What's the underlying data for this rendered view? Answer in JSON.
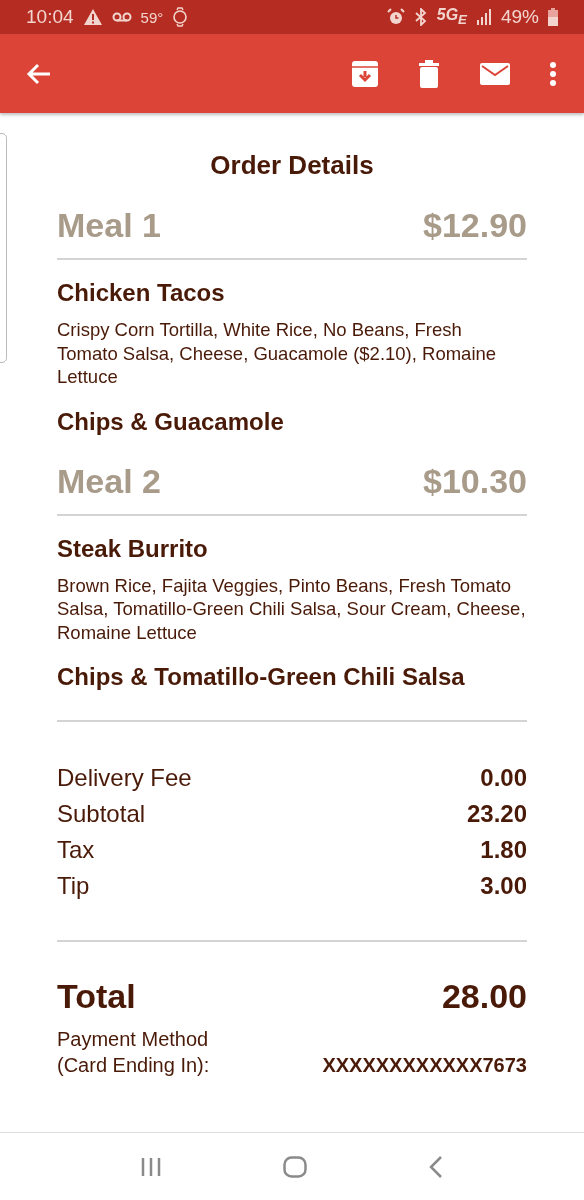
{
  "status_bar": {
    "time": "10:04",
    "temperature": "59°",
    "network": "5G$_{E}$",
    "battery": "49%"
  },
  "title": "Order Details",
  "meals": [
    {
      "name": "Meal 1",
      "price": "$12.90",
      "items": [
        {
          "name": "Chicken Tacos",
          "description": "Crispy Corn Tortilla, White Rice, No Beans, Fresh Tomato Salsa, Cheese, Guacamole ($2.10), Romaine Lettuce"
        },
        {
          "name": "Chips & Guacamole"
        }
      ]
    },
    {
      "name": "Meal 2",
      "price": "$10.30",
      "items": [
        {
          "name": "Steak Burrito",
          "description": "Brown Rice, Fajita Veggies, Pinto Beans, Fresh Tomato Salsa, Tomatillo-Green Chili Salsa, Sour Cream, Cheese, Romaine Lettuce"
        },
        {
          "name": "Chips & Tomatillo-Green Chili Salsa"
        }
      ]
    }
  ],
  "charges": [
    {
      "label": "Delivery Fee",
      "value": "0.00"
    },
    {
      "label": "Subtotal",
      "value": "23.20"
    },
    {
      "label": "Tax",
      "value": "1.80"
    },
    {
      "label": "Tip",
      "value": "3.00"
    }
  ],
  "total": {
    "label": "Total",
    "value": "28.00"
  },
  "payment": {
    "label": "Payment Method",
    "sublabel": "(Card Ending In):",
    "value": "XXXXXXXXXXXX7673"
  }
}
